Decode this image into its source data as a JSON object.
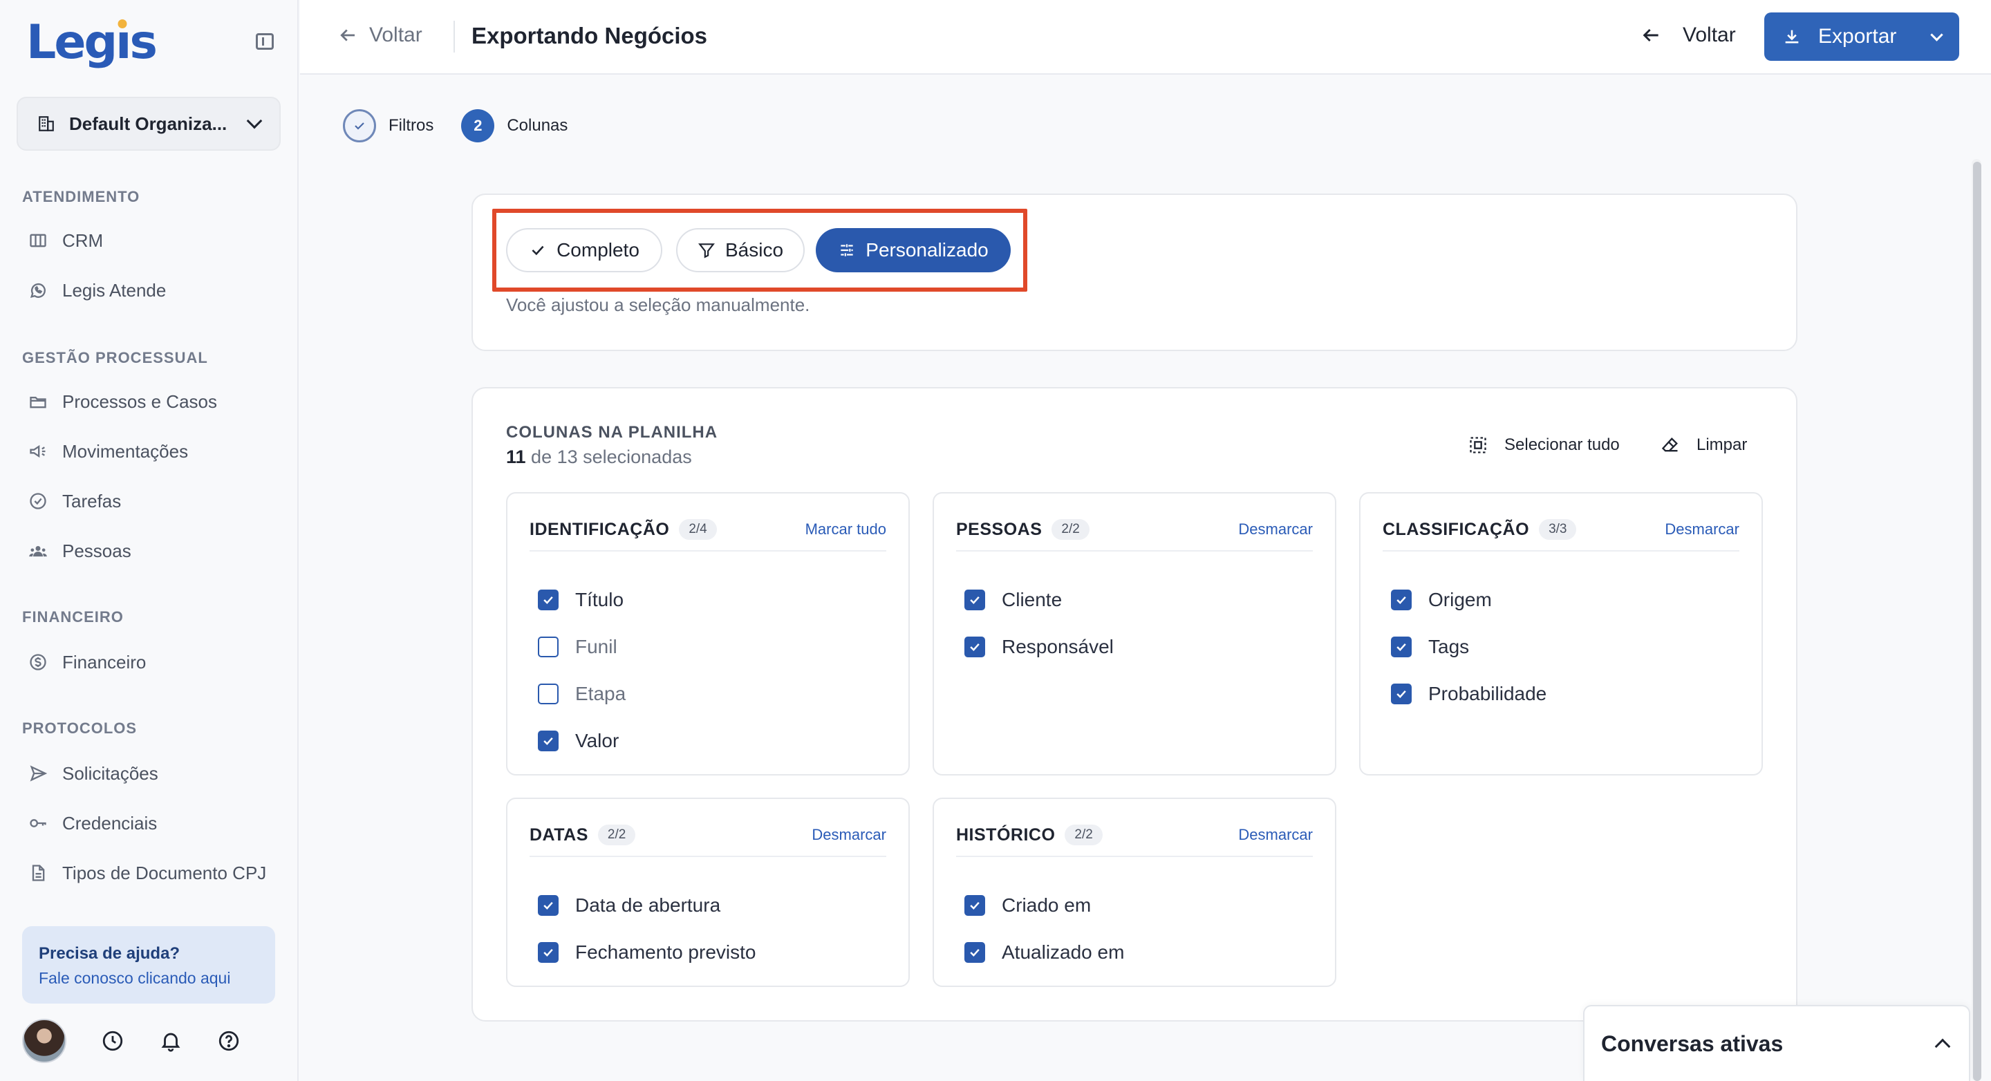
{
  "sidebar": {
    "logo": "Legis",
    "organization": "Default Organiza...",
    "sections": [
      {
        "title": "ATENDIMENTO",
        "items": [
          {
            "label": "CRM",
            "icon": "columns-icon"
          },
          {
            "label": "Legis Atende",
            "icon": "whatsapp-icon"
          }
        ]
      },
      {
        "title": "GESTÃO PROCESSUAL",
        "items": [
          {
            "label": "Processos e Casos",
            "icon": "folder-icon"
          },
          {
            "label": "Movimentações",
            "icon": "megaphone-icon"
          },
          {
            "label": "Tarefas",
            "icon": "check-circle-icon"
          },
          {
            "label": "Pessoas",
            "icon": "people-icon"
          }
        ]
      },
      {
        "title": "FINANCEIRO",
        "items": [
          {
            "label": "Financeiro",
            "icon": "dollar-circle-icon"
          }
        ]
      },
      {
        "title": "PROTOCOLOS",
        "items": [
          {
            "label": "Solicitações",
            "icon": "send-icon"
          },
          {
            "label": "Credenciais",
            "icon": "key-icon"
          },
          {
            "label": "Tipos de Documento CPJ",
            "icon": "document-icon"
          }
        ]
      }
    ],
    "help": {
      "title": "Precisa de ajuda?",
      "subtitle": "Fale conosco clicando aqui"
    }
  },
  "topbar": {
    "back_label": "Voltar",
    "title": "Exportando Negócios",
    "back_right_label": "Voltar",
    "export_label": "Exportar"
  },
  "stepper": [
    {
      "label": "Filtros",
      "state": "done"
    },
    {
      "label": "Colunas",
      "number": "2",
      "state": "active"
    }
  ],
  "presets": {
    "options": [
      "Completo",
      "Básico",
      "Personalizado"
    ],
    "selected": "Personalizado",
    "note": "Você ajustou a seleção manualmente."
  },
  "columns": {
    "heading": "COLUNAS NA PLANILHA",
    "count_selected": "11",
    "count_rest": " de 13 selecionadas",
    "select_all_label": "Selecionar tudo",
    "clear_label": "Limpar",
    "groups": [
      {
        "title": "IDENTIFICAÇÃO",
        "badge": "2/4",
        "action": "Marcar tudo",
        "items": [
          {
            "label": "Título",
            "checked": true
          },
          {
            "label": "Funil",
            "checked": false
          },
          {
            "label": "Etapa",
            "checked": false
          },
          {
            "label": "Valor",
            "checked": true
          }
        ]
      },
      {
        "title": "PESSOAS",
        "badge": "2/2",
        "action": "Desmarcar",
        "items": [
          {
            "label": "Cliente",
            "checked": true
          },
          {
            "label": "Responsável",
            "checked": true
          }
        ]
      },
      {
        "title": "CLASSIFICAÇÃO",
        "badge": "3/3",
        "action": "Desmarcar",
        "items": [
          {
            "label": "Origem",
            "checked": true
          },
          {
            "label": "Tags",
            "checked": true
          },
          {
            "label": "Probabilidade",
            "checked": true
          }
        ]
      },
      {
        "title": "DATAS",
        "badge": "2/2",
        "action": "Desmarcar",
        "items": [
          {
            "label": "Data de abertura",
            "checked": true
          },
          {
            "label": "Fechamento previsto",
            "checked": true
          }
        ]
      },
      {
        "title": "HISTÓRICO",
        "badge": "2/2",
        "action": "Desmarcar",
        "items": [
          {
            "label": "Criado em",
            "checked": true
          },
          {
            "label": "Atualizado em",
            "checked": true
          }
        ]
      }
    ]
  },
  "chat": {
    "title": "Conversas ativas"
  },
  "colors": {
    "primary": "#2a59ad",
    "highlight": "#e0492a",
    "accent_dot": "#f2b33d"
  }
}
